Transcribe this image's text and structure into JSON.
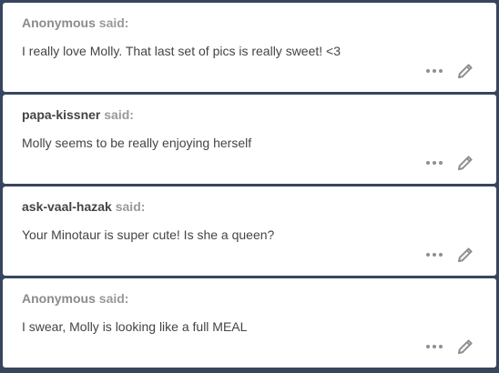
{
  "colors": {
    "background": "#36465d",
    "card": "#ffffff",
    "anonymous_name": "#8b8b8b",
    "username": "#444444",
    "said": "#999999",
    "body_text": "#444444",
    "icon": "#8f8f8f"
  },
  "icons": {
    "more": "ellipsis-icon",
    "edit": "pencil-icon"
  },
  "asks": [
    {
      "asker": "Anonymous",
      "said": "said:",
      "message": "I really love Molly. That last set of pics is really sweet! <3"
    },
    {
      "asker": "papa-kissner",
      "said": "said:",
      "message": "Molly seems to be really enjoying herself"
    },
    {
      "asker": "ask-vaal-hazak",
      "said": "said:",
      "message": "Your Minotaur is super cute! Is she a queen?"
    },
    {
      "asker": "Anonymous",
      "said": "said:",
      "message": "I swear, Molly is looking like a full MEAL"
    }
  ]
}
